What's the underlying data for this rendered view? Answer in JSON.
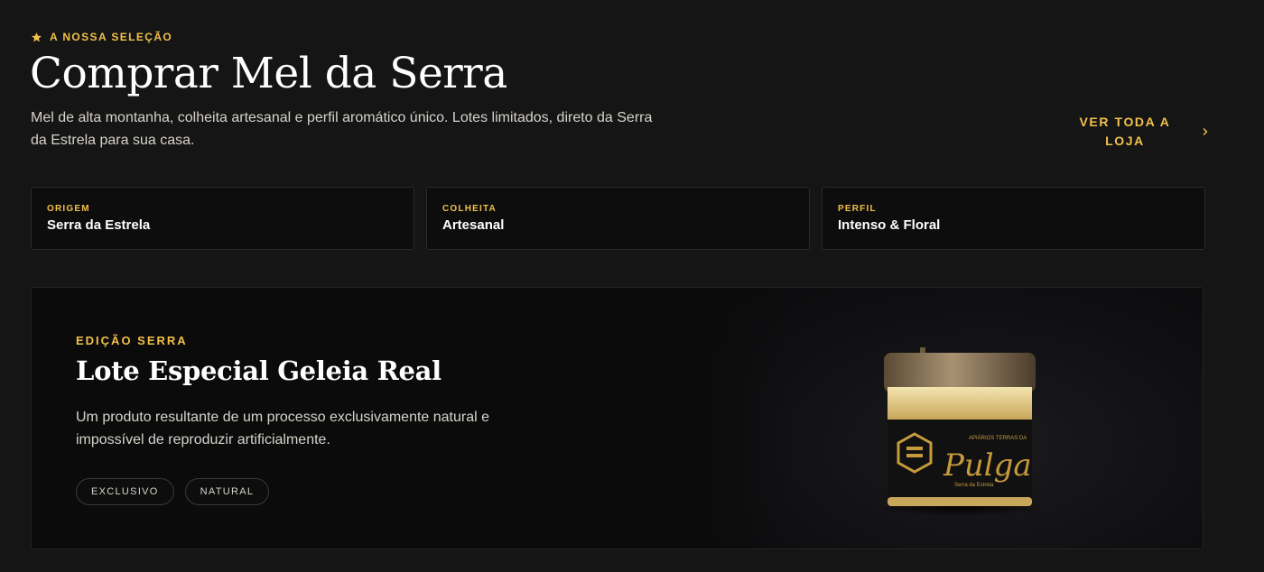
{
  "header": {
    "eyebrow": "A NOSSA SELEÇÃO",
    "title": "Comprar Mel da Serra",
    "subtitle": "Mel de alta montanha, colheita artesanal e perfil aromático único. Lotes limitados, direto da Serra da Estrela para sua casa.",
    "shop_link": "VER TODA A LOJA"
  },
  "facts": [
    {
      "key": "ORIGEM",
      "value": "Serra da Estrela"
    },
    {
      "key": "COLHEITA",
      "value": "Artesanal"
    },
    {
      "key": "PERFIL",
      "value": "Intenso & Floral"
    }
  ],
  "feature": {
    "eyebrow": "EDIÇÃO SERRA",
    "title": "Lote Especial Geleia Real",
    "description": "Um produto resultante de um processo exclusivamente natural e impossível de reproduzir artificialmente.",
    "tags": [
      "EXCLUSIVO",
      "NATURAL"
    ],
    "image": {
      "label_small": "APIÁRIOS TERRAS DA",
      "label_brand": "Pulga",
      "label_sub": "Serra da Estrela"
    }
  },
  "colors": {
    "accent": "#f2c04b",
    "background": "#151515",
    "card": "#0d0d0d"
  }
}
